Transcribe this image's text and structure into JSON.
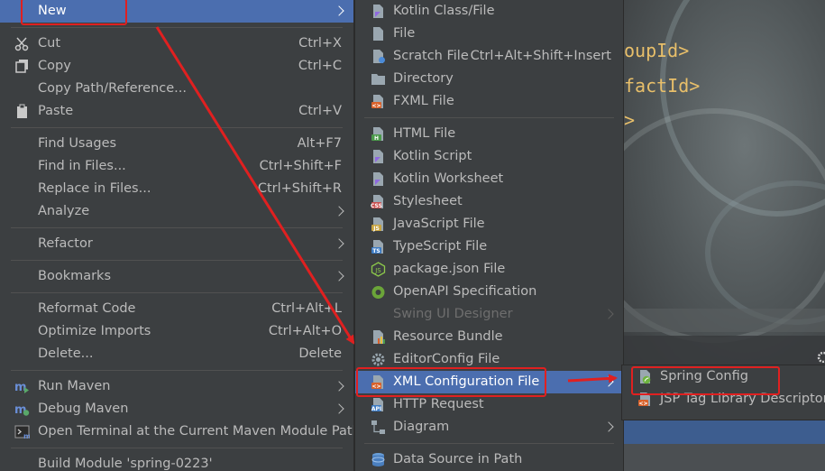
{
  "context_menu": [
    {
      "label": "New",
      "shortcut": "",
      "submenu": true,
      "selected": true,
      "icon": "none"
    },
    {
      "sep": true
    },
    {
      "label": "Cut",
      "shortcut": "Ctrl+X",
      "icon": "scissors-icon"
    },
    {
      "label": "Copy",
      "shortcut": "Ctrl+C",
      "icon": "copy-icon"
    },
    {
      "label": "Copy Path/Reference...",
      "shortcut": "",
      "icon": "none"
    },
    {
      "label": "Paste",
      "shortcut": "Ctrl+V",
      "icon": "paste-icon"
    },
    {
      "sep": true
    },
    {
      "label": "Find Usages",
      "shortcut": "Alt+F7",
      "icon": "none"
    },
    {
      "label": "Find in Files...",
      "shortcut": "Ctrl+Shift+F",
      "icon": "none"
    },
    {
      "label": "Replace in Files...",
      "shortcut": "Ctrl+Shift+R",
      "icon": "none"
    },
    {
      "label": "Analyze",
      "shortcut": "",
      "submenu": true,
      "icon": "none"
    },
    {
      "sep": true
    },
    {
      "label": "Refactor",
      "shortcut": "",
      "submenu": true,
      "icon": "none"
    },
    {
      "sep": true
    },
    {
      "label": "Bookmarks",
      "shortcut": "",
      "submenu": true,
      "icon": "none"
    },
    {
      "sep": true
    },
    {
      "label": "Reformat Code",
      "shortcut": "Ctrl+Alt+L",
      "icon": "none"
    },
    {
      "label": "Optimize Imports",
      "shortcut": "Ctrl+Alt+O",
      "icon": "none"
    },
    {
      "label": "Delete...",
      "shortcut": "Delete",
      "icon": "none"
    },
    {
      "sep": true
    },
    {
      "label": "Run Maven",
      "shortcut": "",
      "submenu": true,
      "icon": "maven-run-icon"
    },
    {
      "label": "Debug Maven",
      "shortcut": "",
      "submenu": true,
      "icon": "maven-debug-icon"
    },
    {
      "label": "Open Terminal at the Current Maven Module Path",
      "shortcut": "",
      "icon": "terminal-icon"
    },
    {
      "sep": true
    },
    {
      "label": "Build Module 'spring-0223'",
      "shortcut": "",
      "icon": "none"
    }
  ],
  "new_submenu": [
    {
      "label": "Kotlin Class/File",
      "icon": "kotlin-file-icon"
    },
    {
      "label": "File",
      "icon": "file-icon"
    },
    {
      "label": "Scratch File",
      "shortcut": "Ctrl+Alt+Shift+Insert",
      "icon": "scratch-file-icon"
    },
    {
      "label": "Directory",
      "icon": "folder-icon"
    },
    {
      "label": "FXML File",
      "icon": "fxml-file-icon"
    },
    {
      "sep": true
    },
    {
      "label": "HTML File",
      "icon": "html-file-icon"
    },
    {
      "label": "Kotlin Script",
      "icon": "kotlin-script-icon"
    },
    {
      "label": "Kotlin Worksheet",
      "icon": "kotlin-worksheet-icon"
    },
    {
      "label": "Stylesheet",
      "icon": "css-file-icon"
    },
    {
      "label": "JavaScript File",
      "icon": "js-file-icon"
    },
    {
      "label": "TypeScript File",
      "icon": "ts-file-icon"
    },
    {
      "label": "package.json File",
      "icon": "nodejs-icon"
    },
    {
      "label": "OpenAPI Specification",
      "icon": "openapi-icon"
    },
    {
      "label": "Swing UI Designer",
      "submenu": true,
      "disabled": true,
      "icon": "none"
    },
    {
      "label": "Resource Bundle",
      "icon": "resource-bundle-icon"
    },
    {
      "label": "EditorConfig File",
      "icon": "gear-icon"
    },
    {
      "label": "XML Configuration File",
      "submenu": true,
      "selected": true,
      "icon": "xml-file-icon"
    },
    {
      "label": "HTTP Request",
      "icon": "api-icon"
    },
    {
      "label": "Diagram",
      "submenu": true,
      "icon": "diagram-icon"
    },
    {
      "sep": true
    },
    {
      "label": "Data Source in Path",
      "icon": "database-icon"
    }
  ],
  "xml_submenu": [
    {
      "label": "Spring Config",
      "icon": "spring-config-icon"
    },
    {
      "label": "JSP Tag Library Descriptor",
      "icon": "xml-file-icon"
    }
  ],
  "editor": {
    "lines": [
      "oupId>",
      "factId>",
      ">"
    ]
  },
  "colors": {
    "menu_bg": "#3c3f41",
    "selection": "#4b6eaf",
    "annotation_red": "#e02020",
    "xml_tag": "#e8bf6a"
  }
}
